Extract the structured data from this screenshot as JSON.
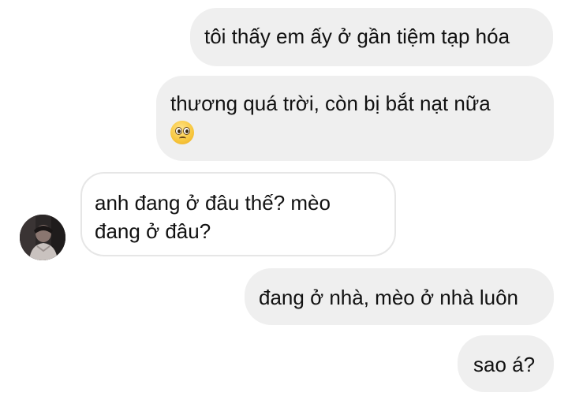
{
  "conversation": {
    "messages": [
      {
        "direction": "outgoing",
        "lines": [
          "tôi thấy em ấy ở gần tiệm tạp hóa"
        ]
      },
      {
        "direction": "outgoing",
        "lines": [
          "thương quá trời, còn bị bắt nạt nữa"
        ],
        "emoji": "pleading-face-icon"
      },
      {
        "direction": "incoming",
        "lines": [
          "anh đang ở đâu thế? mèo",
          "đang ở đâu?"
        ],
        "avatar": "contact-avatar"
      },
      {
        "direction": "outgoing",
        "lines": [
          "đang ở nhà, mèo ở nhà luôn"
        ]
      },
      {
        "direction": "outgoing",
        "lines": [
          "sao á?"
        ]
      }
    ]
  },
  "colors": {
    "outgoing_bubble": "#efefef",
    "incoming_bubble": "#ffffff",
    "incoming_border": "#e6e6e6",
    "text": "#111111",
    "background": "#ffffff"
  }
}
